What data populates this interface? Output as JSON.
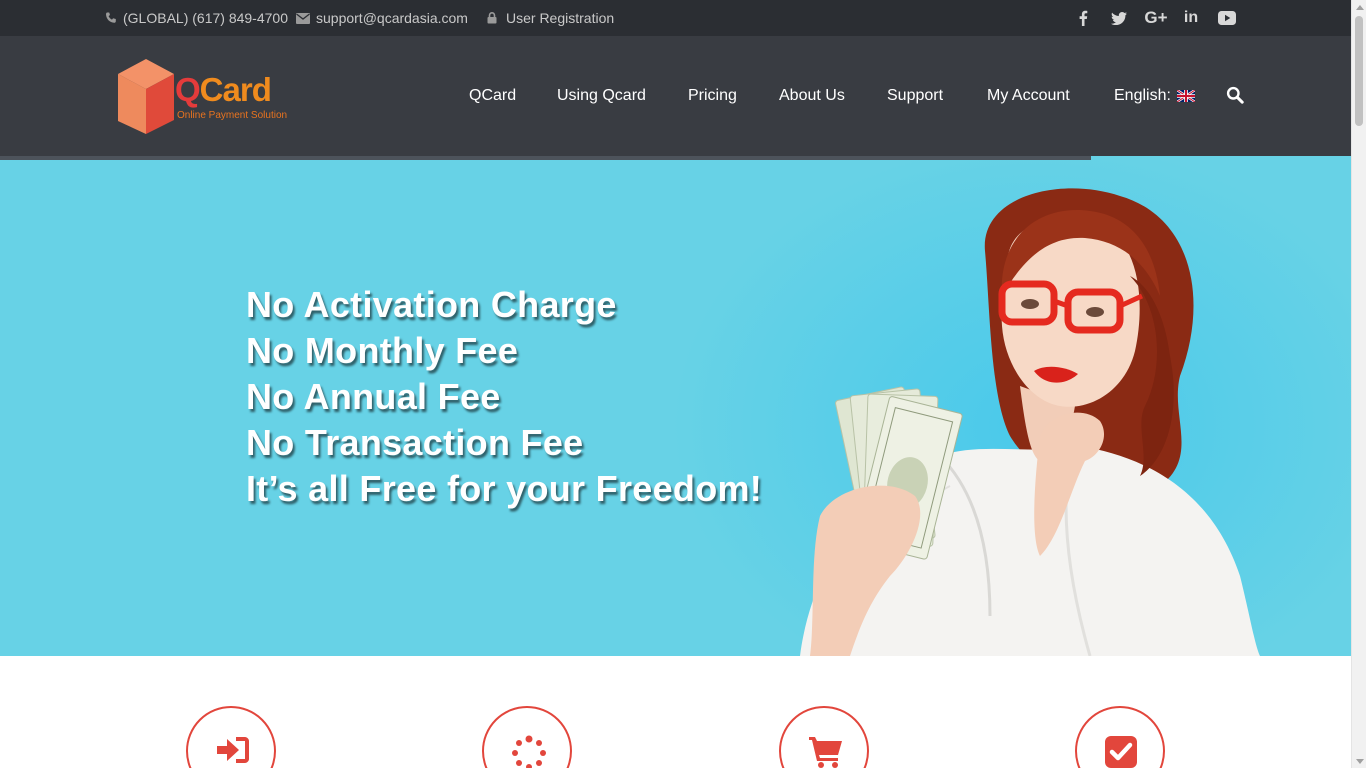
{
  "topbar": {
    "phone": "(GLOBAL) (617) 849-4700",
    "email": "support@qcardasia.com",
    "registration": "User Registration",
    "social": [
      {
        "icon": "facebook-icon",
        "glyph": "f"
      },
      {
        "icon": "twitter-icon",
        "glyph": ""
      },
      {
        "icon": "google-plus-icon",
        "glyph": "G+"
      },
      {
        "icon": "linkedin-icon",
        "glyph": "in"
      },
      {
        "icon": "youtube-icon",
        "glyph": ""
      }
    ]
  },
  "logo": {
    "word_first": "Q",
    "word_rest": "Card",
    "tagline": "Online Payment Solution"
  },
  "nav": {
    "items": [
      "QCard",
      "Using Qcard",
      "Pricing",
      "About Us",
      "Support",
      "My Account"
    ],
    "language": "English:",
    "language_flag": "uk-flag-icon",
    "search_icon": "search-icon"
  },
  "hero": {
    "lines": [
      "No Activation Charge",
      "No Monthly Fee",
      "No Annual Fee",
      "No Transaction Fee",
      "It’s all Free for your Freedom!"
    ],
    "background": "#67d2e6",
    "photo": "woman-with-money-photo"
  },
  "features": [
    {
      "icon": "sign-in-icon"
    },
    {
      "icon": "spinner-icon"
    },
    {
      "icon": "shopping-cart-icon"
    },
    {
      "icon": "check-square-icon"
    }
  ],
  "colors": {
    "topbar_bg": "#2b2e33",
    "header_bg": "#393c42",
    "accent_red": "#e2463c",
    "logo_orange": "#f08b1e"
  }
}
